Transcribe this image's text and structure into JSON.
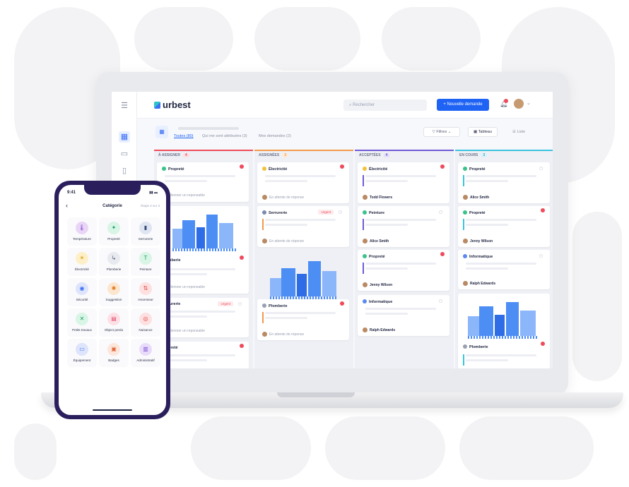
{
  "app": {
    "logo": "urbest",
    "search_placeholder": "Rechercher",
    "new_request": "+ Nouvelle demande",
    "tabs": [
      "Toutes (80)",
      "Qui me sont attribuées (3)",
      "Mes demandes (2)"
    ],
    "filters": "Filtres",
    "views": [
      "Tableau",
      "Liste"
    ]
  },
  "columns": [
    {
      "title": "À ASSIGNER",
      "count": "4",
      "color": "#ef4a5b"
    },
    {
      "title": "ASSIGNÉES",
      "count": "3",
      "color": "#f29a4a"
    },
    {
      "title": "ACCEPTÉES",
      "count": "4",
      "color": "#6f5bd6"
    },
    {
      "title": "EN COURS",
      "count": "3",
      "color": "#3bc3e0"
    }
  ],
  "cards": {
    "c1": {
      "title": "Propreté",
      "foot": "Selectionner un reponsable"
    },
    "c2": {
      "title": "Plomberie",
      "foot": "Selectionner un reponsable"
    },
    "c3": {
      "title": "Serrurerie",
      "urgent": "Urgent",
      "foot": "Selectionner un reponsable"
    },
    "c4": {
      "title": "Propreté"
    },
    "c5": {
      "title": "Électricité",
      "foot": "En attente de réponse"
    },
    "c6": {
      "title": "Serrurerie",
      "urgent": "Urgent",
      "foot": "En attente de réponse"
    },
    "c7": {
      "title": "Plomberie",
      "foot": "En attente de réponse"
    },
    "c8": {
      "title": "Électricité",
      "foot": "Todd Flowers"
    },
    "c9": {
      "title": "Peinture",
      "foot": "Alice Smith"
    },
    "c10": {
      "title": "Propreté",
      "foot": "Jenny Wilson"
    },
    "c11": {
      "title": "Informatique",
      "foot": "Ralph Edwards"
    },
    "c12": {
      "title": "Propreté",
      "foot": "Alice Smith"
    },
    "c13": {
      "title": "Propreté",
      "foot": "Jenny Wilson"
    },
    "c14": {
      "title": "Informatique",
      "foot": "Ralph Edwards"
    },
    "c15": {
      "title": "Plomberie"
    }
  },
  "phone": {
    "time": "9:41",
    "title": "Catégorie",
    "step": "Étape 2 sur 3",
    "categories": [
      {
        "label": "Température",
        "icon": "thermometer-icon",
        "color": "#e9d6f7"
      },
      {
        "label": "Propreté",
        "icon": "sparkle-icon",
        "color": "#d8f5e6"
      },
      {
        "label": "Serrurerie",
        "icon": "door-icon",
        "color": "#dfe6f2"
      },
      {
        "label": "Électricité",
        "icon": "bulb-icon",
        "color": "#fdf0c8"
      },
      {
        "label": "Plomberie",
        "icon": "pipe-icon",
        "color": "#e8eaf0"
      },
      {
        "label": "Peinture",
        "icon": "roller-icon",
        "color": "#d8f5e6"
      },
      {
        "label": "Sécurité",
        "icon": "eye-icon",
        "color": "#dde4fb"
      },
      {
        "label": "Suggestion",
        "icon": "bulb-idea-icon",
        "color": "#fde6cf"
      },
      {
        "label": "Ascenseur",
        "icon": "elevator-icon",
        "color": "#fde0df"
      },
      {
        "label": "Petits travaux",
        "icon": "tools-icon",
        "color": "#d8f5e6"
      },
      {
        "label": "Object perdu",
        "icon": "box-icon",
        "color": "#fde0e6"
      },
      {
        "label": "Nuisance",
        "icon": "noise-icon",
        "color": "#fde0df"
      },
      {
        "label": "Équipement",
        "icon": "monitor-icon",
        "color": "#dde4fb"
      },
      {
        "label": "Badges",
        "icon": "badge-icon",
        "color": "#fde6dc"
      },
      {
        "label": "Administratif",
        "icon": "document-icon",
        "color": "#e9dcfb"
      }
    ]
  }
}
